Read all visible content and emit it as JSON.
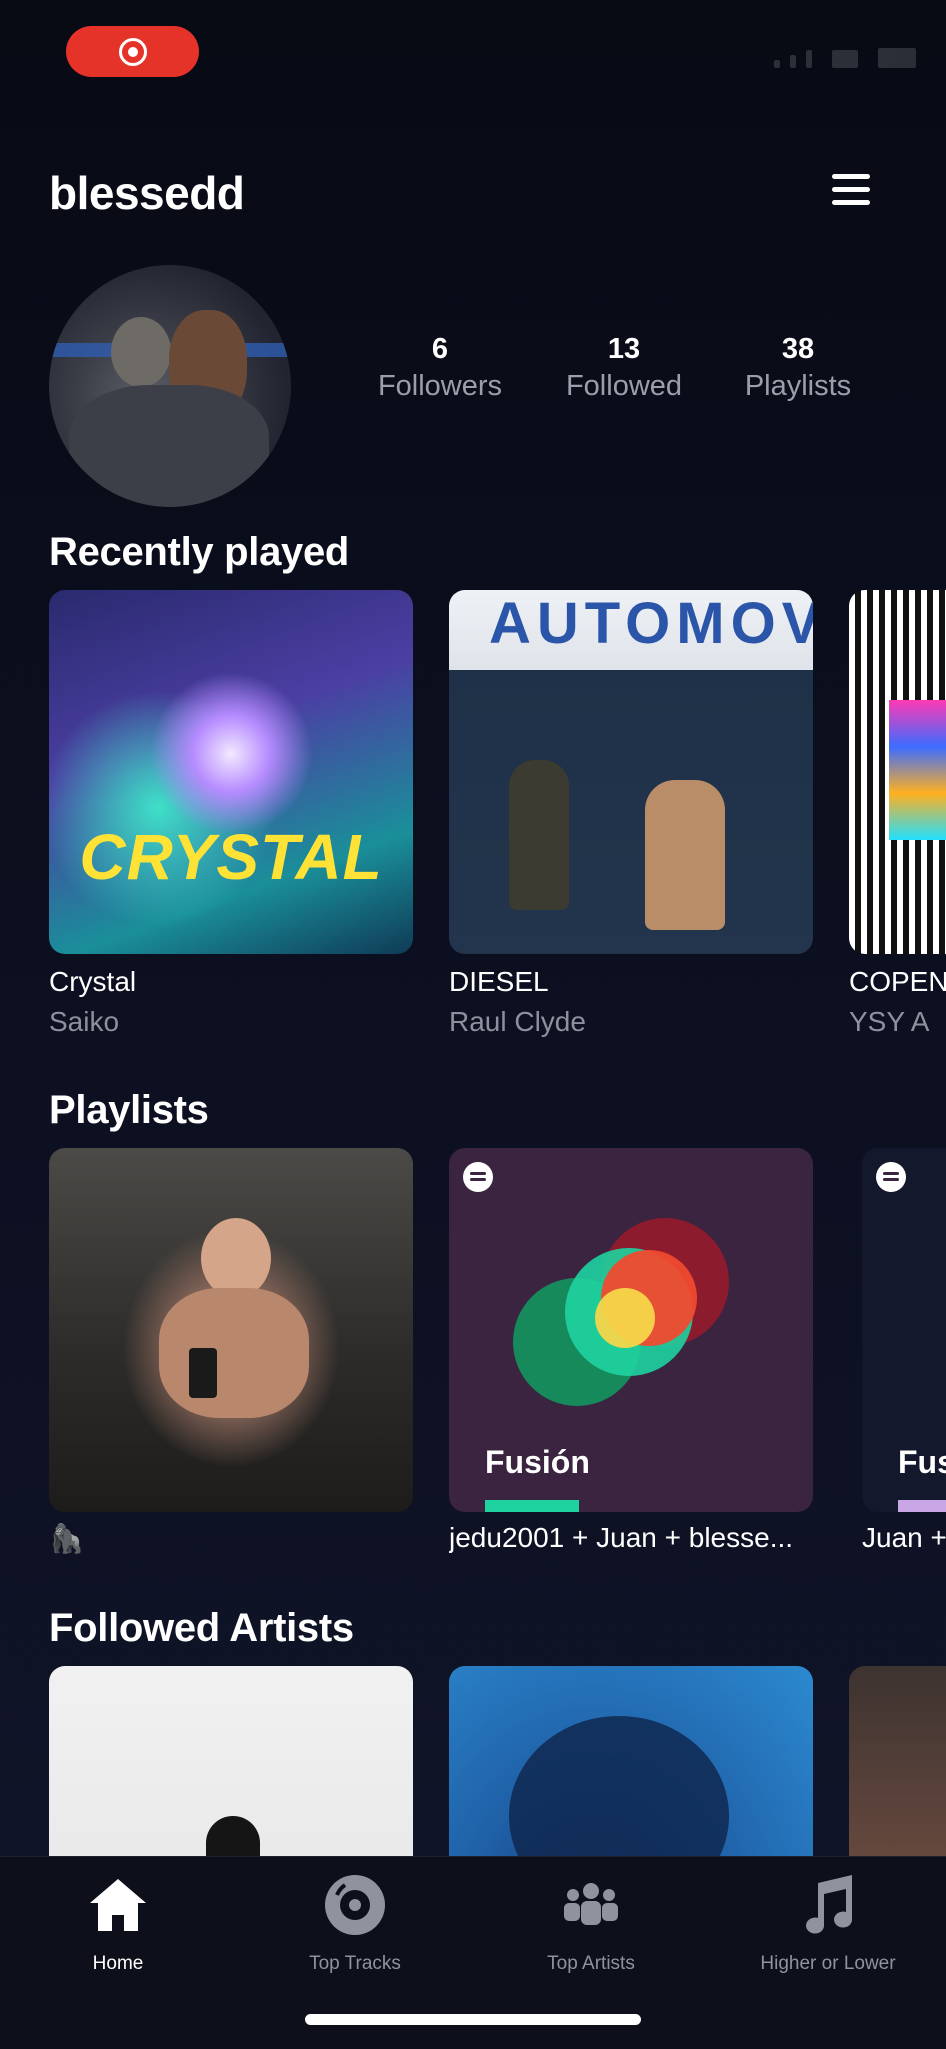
{
  "header": {
    "username": "blessedd"
  },
  "profile": {
    "stats": [
      {
        "value": "6",
        "label": "Followers"
      },
      {
        "value": "13",
        "label": "Followed"
      },
      {
        "value": "38",
        "label": "Playlists"
      }
    ]
  },
  "recently_played": {
    "title": "Recently played",
    "items": [
      {
        "title": "Crystal",
        "artist": "Saiko",
        "cover_text": "CRYSTAL"
      },
      {
        "title": "DIESEL",
        "artist": "Raul Clyde",
        "cover_text": "AUTOMOV"
      },
      {
        "title": "COPEN",
        "artist": "YSY A"
      }
    ]
  },
  "playlists": {
    "title": "Playlists",
    "items": [
      {
        "caption": "🦍"
      },
      {
        "name": "Fusión",
        "caption": "jedu2001 + Juan + blesse...",
        "bar_color": "#1ed3a0"
      },
      {
        "name": "Fus",
        "caption": "Juan +",
        "bar_color": "#c9a6e6"
      }
    ]
  },
  "followed_artists": {
    "title": "Followed Artists"
  },
  "tabbar": {
    "tabs": [
      {
        "label": "Home",
        "icon": "home-icon",
        "active": true
      },
      {
        "label": "Top Tracks",
        "icon": "disc-icon",
        "active": false
      },
      {
        "label": "Top Artists",
        "icon": "group-icon",
        "active": false
      },
      {
        "label": "Higher or Lower",
        "icon": "music-note-icon",
        "active": false
      }
    ]
  },
  "colors": {
    "accent_record": "#e6332a",
    "background": "#0c0f1f",
    "fusion_card": "#3a2440"
  }
}
